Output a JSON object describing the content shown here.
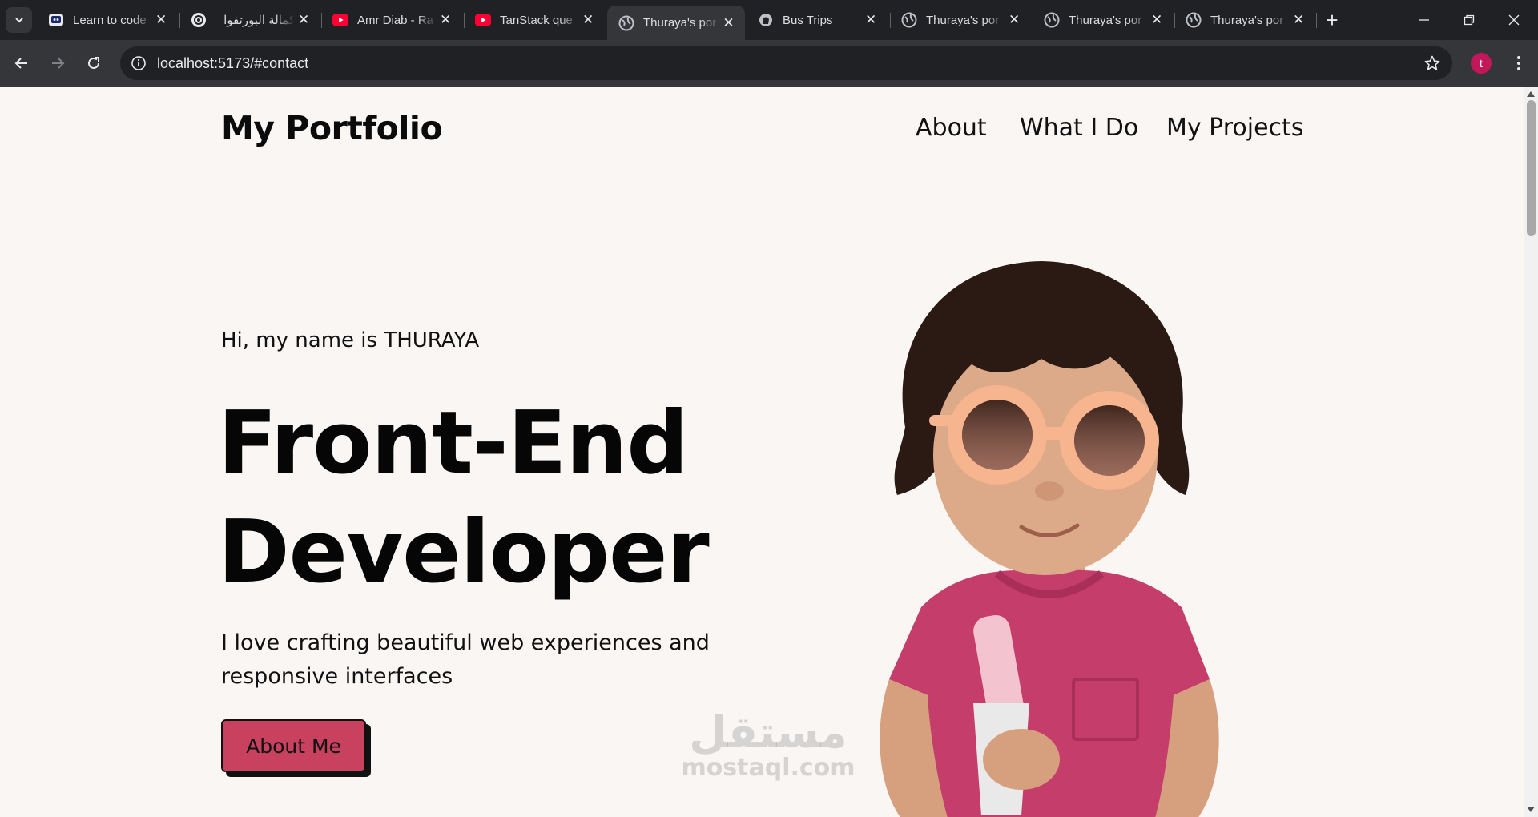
{
  "browser": {
    "tabs": [
      {
        "title": "Learn to code",
        "icon": "code-site-icon",
        "active": false
      },
      {
        "title": "كمالة البورتفوا",
        "icon": "chatgpt-icon",
        "active": false
      },
      {
        "title": "Amr Diab - Ra",
        "icon": "youtube-icon",
        "active": false
      },
      {
        "title": "TanStack que",
        "icon": "youtube-icon",
        "active": false
      },
      {
        "title": "Thuraya's por",
        "icon": "globe-icon",
        "active": true
      },
      {
        "title": "Bus Trips",
        "icon": "github-icon",
        "active": false
      },
      {
        "title": "Thuraya's por",
        "icon": "globe-icon",
        "active": false
      },
      {
        "title": "Thuraya's por",
        "icon": "globe-icon",
        "active": false
      },
      {
        "title": "Thuraya's por",
        "icon": "globe-icon",
        "active": false
      }
    ],
    "url": "localhost:5173/#contact",
    "profile_initial": "t",
    "profile_color": "#c2185b"
  },
  "page": {
    "brand": "My Portfolio",
    "nav": [
      "About",
      "What I Do",
      "My Projects"
    ],
    "greeting": "Hi, my name is THURAYA",
    "headline_line1": "Front-End",
    "headline_line2": "Developer",
    "tagline": "I love crafting beautiful web experiences and responsive interfaces",
    "cta_label": "About Me",
    "accent_color": "#c8415f",
    "background_color": "#f9f6f3"
  },
  "watermark": {
    "arabic": "مستقل",
    "latin": "mostaql.com"
  }
}
